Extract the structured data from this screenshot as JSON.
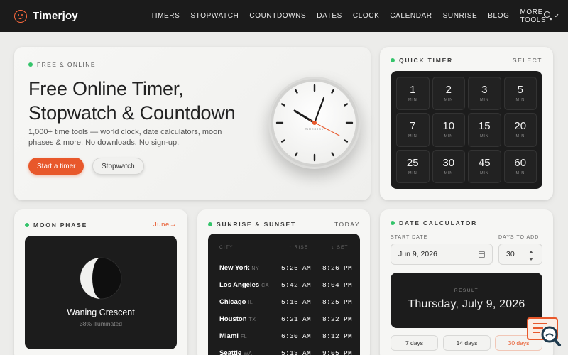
{
  "nav": {
    "brand": "Timerjoy",
    "items": [
      "TIMERS",
      "STOPWATCH",
      "COUNTDOWNS",
      "DATES",
      "CLOCK",
      "CALENDAR",
      "SUNRISE",
      "BLOG"
    ],
    "more": "MORE TOOLS"
  },
  "hero": {
    "badge": "FREE & ONLINE",
    "title_line1": "Free Online Timer,",
    "title_line2": "Stopwatch & Countdown",
    "subtitle": "1,000+ time tools — world clock, date calculators, moon phases & more. No downloads. No sign-up.",
    "primary_button": "Start a timer",
    "secondary_button": "Stopwatch",
    "clock_brand": "TIMERJOY"
  },
  "quick_timer": {
    "title": "QUICK TIMER",
    "action": "SELECT",
    "unit": "MIN",
    "values": [
      "1",
      "2",
      "3",
      "5",
      "7",
      "10",
      "15",
      "20",
      "25",
      "30",
      "45",
      "60"
    ]
  },
  "moon": {
    "title": "MOON PHASE",
    "link": "June→",
    "phase": "Waning Crescent",
    "illumination": "38% illuminated",
    "illumination_fraction": 0.38
  },
  "sun": {
    "title": "SUNRISE & SUNSET",
    "aside": "TODAY",
    "col_city": "CITY",
    "col_rise": "↑ RISE",
    "col_set": "↓ SET",
    "rows": [
      {
        "city": "New York",
        "state": "NY",
        "rise": "5:26 AM",
        "set": "8:26 PM"
      },
      {
        "city": "Los Angeles",
        "state": "CA",
        "rise": "5:42 AM",
        "set": "8:04 PM"
      },
      {
        "city": "Chicago",
        "state": "IL",
        "rise": "5:16 AM",
        "set": "8:25 PM"
      },
      {
        "city": "Houston",
        "state": "TX",
        "rise": "6:21 AM",
        "set": "8:22 PM"
      },
      {
        "city": "Miami",
        "state": "FL",
        "rise": "6:30 AM",
        "set": "8:12 PM"
      },
      {
        "city": "Seattle",
        "state": "WA",
        "rise": "5:13 AM",
        "set": "9:05 PM"
      }
    ]
  },
  "date_calc": {
    "title": "DATE CALCULATOR",
    "start_label": "START DATE",
    "start_value": "Jun 9, 2026",
    "days_label": "DAYS TO ADD",
    "days_value": "30",
    "result_label": "RESULT",
    "result_value": "Thursday, July 9, 2026",
    "presets": [
      "7 days",
      "14 days",
      "30 days"
    ]
  },
  "colors": {
    "accent": "#e8582b",
    "brand_icon": "#ff6a3d",
    "status_dot": "#35c46b",
    "panel": "#1c1c1c",
    "nav": "#1b1b1b"
  }
}
